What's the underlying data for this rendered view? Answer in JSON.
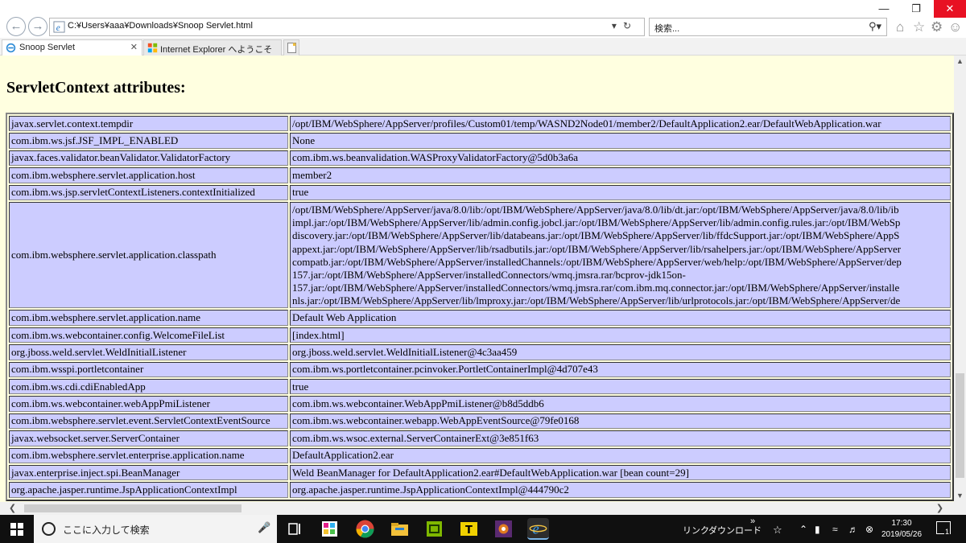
{
  "browser": {
    "address": "C:¥Users¥aaa¥Downloads¥Snoop Servlet.html",
    "search_placeholder": "検索...",
    "tabs": [
      {
        "label": "Snoop Servlet",
        "active": true
      },
      {
        "label": "Internet Explorer へようこそ",
        "active": false
      }
    ],
    "window_controls": {
      "minimize": "—",
      "restore": "❐",
      "close": "✕"
    }
  },
  "page": {
    "heading": "ServletContext attributes:",
    "rows": [
      {
        "key": "javax.servlet.context.tempdir",
        "value": "/opt/IBM/WebSphere/AppServer/profiles/Custom01/temp/WASND2Node01/member2/DefaultApplication2.ear/DefaultWebApplication.war"
      },
      {
        "key": "com.ibm.ws.jsf.JSF_IMPL_ENABLED",
        "value": "None"
      },
      {
        "key": "javax.faces.validator.beanValidator.ValidatorFactory",
        "value": "com.ibm.ws.beanvalidation.WASProxyValidatorFactory@5d0b3a6a"
      },
      {
        "key": "com.ibm.websphere.servlet.application.host",
        "value": "member2"
      },
      {
        "key": "com.ibm.ws.jsp.servletContextListeners.contextInitialized",
        "value": "true"
      }
    ],
    "classpath_row": {
      "key": "com.ibm.websphere.servlet.application.classpath",
      "lines": [
        "/opt/IBM/WebSphere/AppServer/java/8.0/lib:/opt/IBM/WebSphere/AppServer/java/8.0/lib/dt.jar:/opt/IBM/WebSphere/AppServer/java/8.0/lib/ib",
        "impl.jar:/opt/IBM/WebSphere/AppServer/lib/admin.config.jobcl.jar:/opt/IBM/WebSphere/AppServer/lib/admin.config.rules.jar:/opt/IBM/WebSp",
        "discovery.jar:/opt/IBM/WebSphere/AppServer/lib/databeans.jar:/opt/IBM/WebSphere/AppServer/lib/ffdcSupport.jar:/opt/IBM/WebSphere/AppS",
        "appext.jar:/opt/IBM/WebSphere/AppServer/lib/rsadbutils.jar:/opt/IBM/WebSphere/AppServer/lib/rsahelpers.jar:/opt/IBM/WebSphere/AppServer",
        "compatb.jar:/opt/IBM/WebSphere/AppServer/installedChannels:/opt/IBM/WebSphere/AppServer/web/help:/opt/IBM/WebSphere/AppServer/dep",
        "157.jar:/opt/IBM/WebSphere/AppServer/installedConnectors/wmq.jmsra.rar/bcprov-jdk15on-",
        "157.jar:/opt/IBM/WebSphere/AppServer/installedConnectors/wmq.jmsra.rar/com.ibm.mq.connector.jar:/opt/IBM/WebSphere/AppServer/installe",
        "nls.jar:/opt/IBM/WebSphere/AppServer/lib/lmproxy.jar:/opt/IBM/WebSphere/AppServer/lib/urlprotocols.jar:/opt/IBM/WebSphere/AppServer/de"
      ]
    },
    "rows_after": [
      {
        "key": "com.ibm.websphere.servlet.application.name",
        "value": "Default Web Application"
      },
      {
        "key": "com.ibm.ws.webcontainer.config.WelcomeFileList",
        "value": "[index.html]"
      },
      {
        "key": "org.jboss.weld.servlet.WeldInitialListener",
        "value": "org.jboss.weld.servlet.WeldInitialListener@4c3aa459"
      },
      {
        "key": "com.ibm.wsspi.portletcontainer",
        "value": "com.ibm.ws.portletcontainer.pcinvoker.PortletContainerImpl@4d707e43"
      },
      {
        "key": "com.ibm.ws.cdi.cdiEnabledApp",
        "value": "true"
      },
      {
        "key": "com.ibm.ws.webcontainer.webAppPmiListener",
        "value": "com.ibm.ws.webcontainer.WebAppPmiListener@b8d5ddb6"
      },
      {
        "key": "com.ibm.websphere.servlet.event.ServletContextEventSource",
        "value": "com.ibm.ws.webcontainer.webapp.WebAppEventSource@79fe0168"
      },
      {
        "key": "javax.websocket.server.ServerContainer",
        "value": "com.ibm.ws.wsoc.external.ServerContainerExt@3e851f63"
      },
      {
        "key": "com.ibm.websphere.servlet.enterprise.application.name",
        "value": "DefaultApplication2.ear"
      },
      {
        "key": "javax.enterprise.inject.spi.BeanManager",
        "value": "Weld BeanManager for DefaultApplication2.ear#DefaultWebApplication.war [bean count=29]"
      },
      {
        "key": "org.apache.jasper.runtime.JspApplicationContextImpl",
        "value": "org.apache.jasper.runtime.JspApplicationContextImpl@444790c2"
      }
    ],
    "colors": {
      "background": "#ffffe0",
      "cell": "#ccccff"
    }
  },
  "taskbar": {
    "search_placeholder": "ここに入力して検索",
    "tray_links": "リンク",
    "tray_downloads": "ダウンロード",
    "tray_chevron": "»",
    "time": "17:30",
    "date": "2019/05/26",
    "notification_count": "1"
  }
}
